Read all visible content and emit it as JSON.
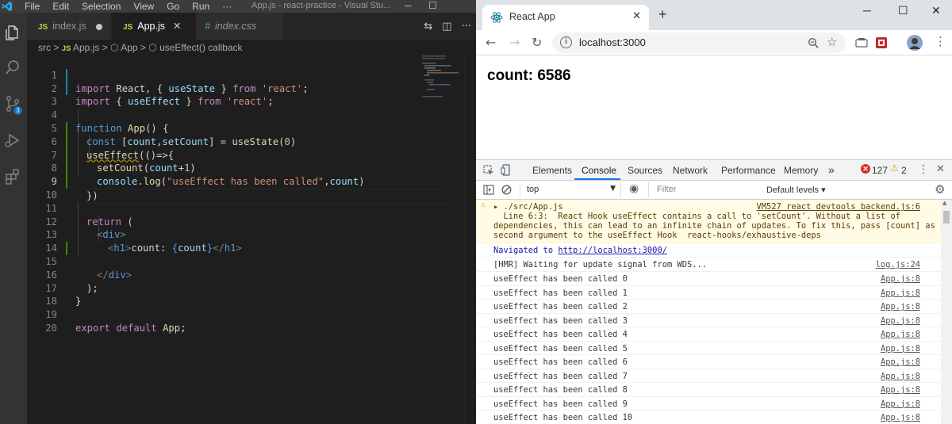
{
  "vscode": {
    "menu": [
      "File",
      "Edit",
      "Selection",
      "View",
      "Go",
      "Run",
      "···"
    ],
    "window_title": "App.js - react-practice - Visual Stu...",
    "activity_badges": {
      "scm": "3"
    },
    "tabs": [
      {
        "label": "index.js",
        "type": "JS",
        "state": "unsaved"
      },
      {
        "label": "App.js",
        "type": "JS",
        "state": "active"
      },
      {
        "label": "index.css",
        "type": "#",
        "state": "preview"
      }
    ],
    "breadcrumb": [
      "src",
      "App.js",
      "App",
      "useEffect() callback"
    ],
    "code_lines": [
      {
        "n": "1"
      },
      {
        "n": "2"
      },
      {
        "n": "3"
      },
      {
        "n": "4"
      },
      {
        "n": "5"
      },
      {
        "n": "6"
      },
      {
        "n": "7"
      },
      {
        "n": "8"
      },
      {
        "n": "9"
      },
      {
        "n": "10"
      },
      {
        "n": "11"
      },
      {
        "n": "12"
      },
      {
        "n": "13"
      },
      {
        "n": "14"
      },
      {
        "n": "15"
      },
      {
        "n": "16"
      },
      {
        "n": "17"
      },
      {
        "n": "18"
      },
      {
        "n": "19"
      },
      {
        "n": "20"
      }
    ],
    "code": {
      "l1": [
        "import",
        " React, { ",
        "useState",
        " } ",
        "from",
        " ",
        "'react'",
        ";"
      ],
      "l2": [
        "import",
        " { ",
        "useEffect",
        " } ",
        "from",
        " ",
        "'react'",
        ";"
      ],
      "l4": [
        "function",
        " ",
        "App",
        "() {"
      ],
      "l5": [
        "const",
        " [",
        "count",
        ",",
        "setCount",
        "] = ",
        "useState",
        "(",
        "0",
        ")"
      ],
      "l6": [
        "useEffect",
        "(()=>{"
      ],
      "l7": [
        "setCount",
        "(",
        "count",
        "+",
        "1",
        ")"
      ],
      "l8": [
        "console",
        ".",
        "log",
        "(",
        "\"useEffect has been called\"",
        ",",
        "count",
        ")"
      ],
      "l9": [
        "})"
      ],
      "l11": [
        "return",
        " ("
      ],
      "l12": [
        "<",
        "div",
        ">"
      ],
      "l13": [
        "<",
        "h1",
        ">",
        "count: ",
        "{",
        "count",
        "}",
        "</",
        "h1",
        ">"
      ],
      "l15": [
        "</",
        "div",
        ">"
      ],
      "l16": [
        ");"
      ],
      "l17": [
        "}"
      ],
      "l19": [
        "export",
        " ",
        "default",
        " ",
        "App",
        ";"
      ]
    }
  },
  "chrome": {
    "tab_title": "React App",
    "url": "localhost:3000",
    "page_heading": "count: 6586",
    "devtools": {
      "tabs": [
        "Elements",
        "Console",
        "Sources",
        "Network",
        "Performance",
        "Memory",
        "»"
      ],
      "active_tab": "Console",
      "error_count": "127",
      "warning_count": "2",
      "context": "top",
      "filter_placeholder": "Filter",
      "levels": "Default levels ▾",
      "warning": {
        "title": "▸ ./src/App.js",
        "source": "VM527 react devtools backend.js:6",
        "body": [
          "  Line 6:3:  React Hook useEffect contains a call to 'setCount'. Without a list of",
          "dependencies, this can lead to an infinite chain of updates. To fix this, pass [count] as a",
          "second argument to the useEffect Hook  react-hooks/exhaustive-deps"
        ]
      },
      "navigated": "Navigated to ",
      "navigated_url": "http://localhost:3000/",
      "hmr": "[HMR] Waiting for update signal from WDS...",
      "hmr_source": "log.js:24",
      "logs": [
        {
          "text": "useEffect has been called 0",
          "src": "App.js:8"
        },
        {
          "text": "useEffect has been called 1",
          "src": "App.js:8"
        },
        {
          "text": "useEffect has been called 2",
          "src": "App.js:8"
        },
        {
          "text": "useEffect has been called 3",
          "src": "App.js:8"
        },
        {
          "text": "useEffect has been called 4",
          "src": "App.js:8"
        },
        {
          "text": "useEffect has been called 5",
          "src": "App.js:8"
        },
        {
          "text": "useEffect has been called 6",
          "src": "App.js:8"
        },
        {
          "text": "useEffect has been called 7",
          "src": "App.js:8"
        },
        {
          "text": "useEffect has been called 8",
          "src": "App.js:8"
        },
        {
          "text": "useEffect has been called 9",
          "src": "App.js:8"
        },
        {
          "text": "useEffect has been called 10",
          "src": "App.js:8"
        }
      ]
    }
  }
}
